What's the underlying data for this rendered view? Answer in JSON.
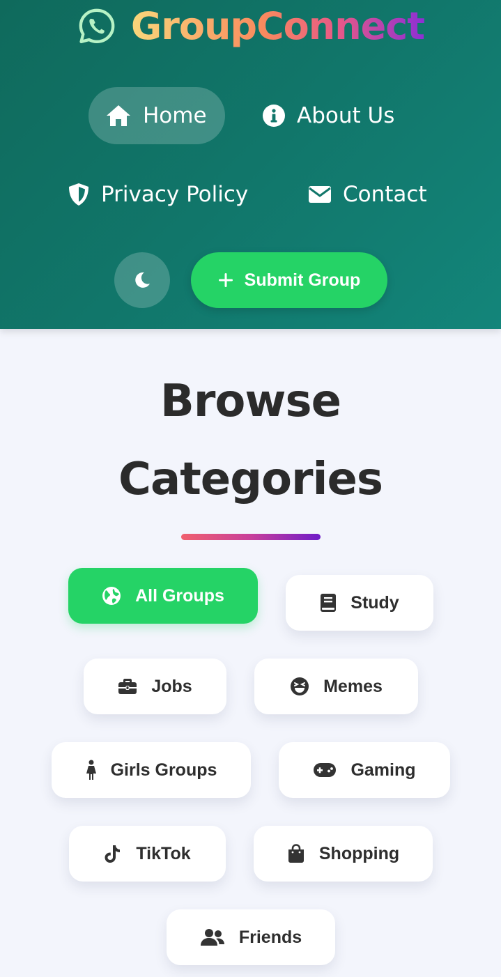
{
  "brand": {
    "name": "GroupConnect",
    "icon": "whatsapp-icon"
  },
  "nav": {
    "home": {
      "label": "Home",
      "icon": "home-icon"
    },
    "about": {
      "label": "About Us",
      "icon": "info-icon"
    },
    "privacy": {
      "label": "Privacy Policy",
      "icon": "shield-icon"
    },
    "contact": {
      "label": "Contact",
      "icon": "envelope-icon"
    }
  },
  "actions": {
    "theme_toggle_icon": "moon-icon",
    "submit_label": "Submit Group",
    "submit_icon": "plus-icon"
  },
  "section": {
    "title_line1": "Browse",
    "title_line2": "Categories"
  },
  "categories": [
    {
      "label": "All Groups",
      "icon": "globe-icon",
      "active": true
    },
    {
      "label": "Study",
      "icon": "book-icon"
    },
    {
      "label": "Jobs",
      "icon": "briefcase-icon"
    },
    {
      "label": "Memes",
      "icon": "laughing-face-icon"
    },
    {
      "label": "Girls Groups",
      "icon": "female-icon"
    },
    {
      "label": "Gaming",
      "icon": "gamepad-icon"
    },
    {
      "label": "TikTok",
      "icon": "tiktok-icon"
    },
    {
      "label": "Shopping",
      "icon": "shopping-bag-icon"
    },
    {
      "label": "Friends",
      "icon": "users-icon"
    }
  ],
  "colors": {
    "header_bg": "#11766a",
    "accent_green": "#25d366",
    "page_bg": "#f3f5fc",
    "text_dark": "#2b2b2b"
  }
}
